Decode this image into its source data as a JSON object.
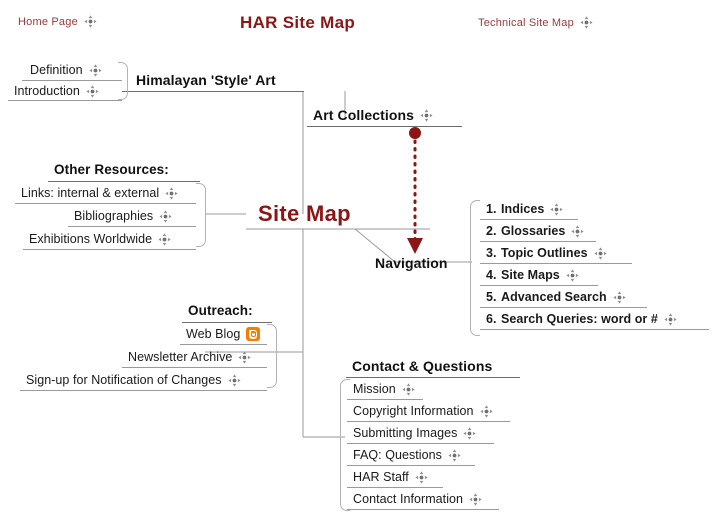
{
  "page": {
    "title": "HAR Site Map",
    "root_label": "Site Map",
    "accent_red": "#8a1616",
    "link_red": "#9a3a3a",
    "blogger_orange": "#f57d00",
    "line_grey": "#9a9a9a"
  },
  "top_links": [
    {
      "label": "Home Page",
      "icon": "move-icon"
    },
    {
      "label": "Technical Site Map",
      "icon": "move-icon"
    }
  ],
  "branches": {
    "himalayan": {
      "parent": "Himalayan 'Style' Art",
      "items": [
        {
          "label": "Definition",
          "icon": "move-icon"
        },
        {
          "label": "Introduction",
          "icon": "move-icon"
        }
      ]
    },
    "art_collections": {
      "parent": "Art Collections",
      "icon": "move-icon"
    },
    "other_resources": {
      "parent": "Other Resources:",
      "items": [
        {
          "label": "Links: internal & external",
          "icon": "move-icon"
        },
        {
          "label": "Bibliographies",
          "icon": "move-icon"
        },
        {
          "label": "Exhibitions Worldwide",
          "icon": "move-icon"
        }
      ]
    },
    "navigation": {
      "parent": "Navigation",
      "items": [
        {
          "num": "1.",
          "label": "Indices",
          "icon": "move-icon"
        },
        {
          "num": "2.",
          "label": "Glossaries",
          "icon": "move-icon"
        },
        {
          "num": "3.",
          "label": "Topic Outlines",
          "icon": "move-icon"
        },
        {
          "num": "4.",
          "label": "Site Maps",
          "icon": "move-icon"
        },
        {
          "num": "5.",
          "label": "Advanced Search",
          "icon": "move-icon"
        },
        {
          "num": "6.",
          "label": "Search Queries: word or #",
          "icon": "move-icon"
        }
      ]
    },
    "outreach": {
      "parent": "Outreach:",
      "items": [
        {
          "label": "Web Blog",
          "icon": "blogger-icon"
        },
        {
          "label": "Newsletter Archive",
          "icon": "move-icon"
        },
        {
          "label": "Sign-up for Notification of Changes",
          "icon": "move-icon"
        }
      ]
    },
    "contact": {
      "parent": "Contact & Questions",
      "items": [
        {
          "label": "Mission",
          "icon": "move-icon"
        },
        {
          "label": "Copyright Information",
          "icon": "move-icon"
        },
        {
          "label": "Submitting Images",
          "icon": "move-icon"
        },
        {
          "label": "FAQ: Questions",
          "icon": "move-icon"
        },
        {
          "label": "HAR Staff",
          "icon": "move-icon"
        },
        {
          "label": "Contact Information",
          "icon": "move-icon"
        }
      ]
    }
  },
  "annotation": {
    "type": "dotted-arrow",
    "from": "Art Collections",
    "to": "Navigation",
    "color": "#8a1616"
  }
}
